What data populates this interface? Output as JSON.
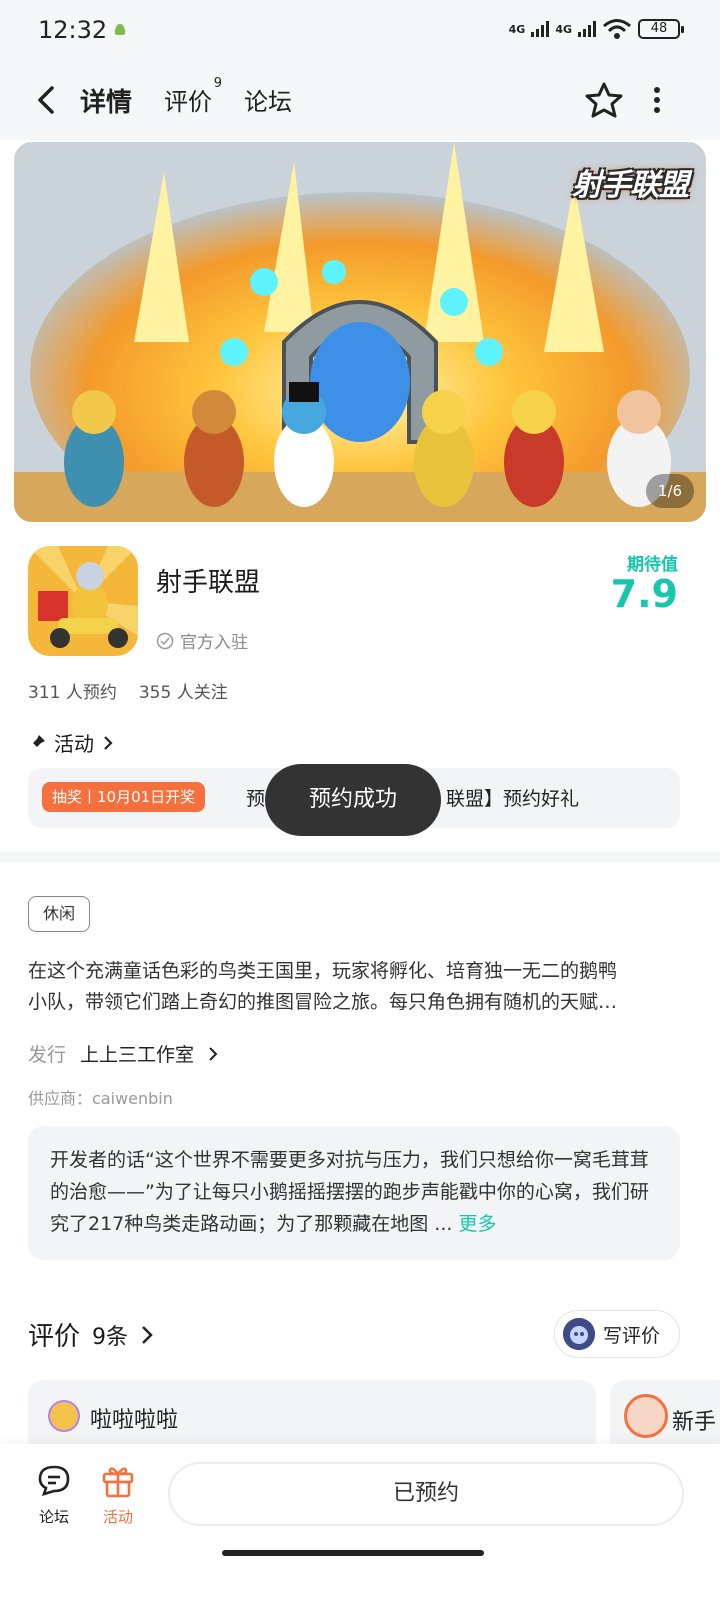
{
  "status_bar": {
    "time": "12:32",
    "network_1": "4G",
    "network_2": "4G",
    "battery": "48"
  },
  "header": {
    "tabs": [
      {
        "label": "详情",
        "active": true
      },
      {
        "label": "评价",
        "badge": "9"
      },
      {
        "label": "论坛"
      }
    ]
  },
  "banner": {
    "logo_text": "射手联盟",
    "counter": "1/6"
  },
  "app": {
    "name": "射手联盟",
    "official_label": "官方入驻",
    "expect_label": "期待值",
    "expect_value": "7.9",
    "reserve_count": "311 人预约",
    "follow_count": "355 人关注"
  },
  "activity": {
    "title": "活动",
    "lottery_tag": "抽奖丨10月01日开奖",
    "text_before": "预",
    "text_after": "联盟】预约好礼",
    "toast": "预约成功"
  },
  "details": {
    "tag": "休闲",
    "description_line1": "在这个充满童话色彩的鸟类王国里，玩家将孵化、培育独一无二的鹅鸭",
    "description_line2": "小队，带领它们踏上奇幻的推图冒险之旅。每只角色拥有随机的天赋…",
    "publisher_label": "发行",
    "publisher_value": "上上三工作室",
    "supplier": "供应商：caiwenbin",
    "dev_words": "开发者的话“这个世界不需要更多对抗与压力，我们只想给你一窝毛茸茸的治愈——”为了让每只小鹅摇摇摆摆的跑步声能戳中你的心窝，我们研究了217种鸟类走路动画；为了那颗藏在地图 ...",
    "dev_more": "更多"
  },
  "reviews": {
    "title": "评价",
    "count": "9条",
    "write_button": "写评价",
    "items": [
      {
        "name": "啦啦啦啦"
      },
      {
        "name": "新手"
      }
    ]
  },
  "bottom_bar": {
    "forum_label": "论坛",
    "activity_label": "活动",
    "reserved_button": "已预约"
  },
  "colors": {
    "accent": "#17c7ad",
    "orange": "#f5703c",
    "toast_bg": "#333333"
  }
}
